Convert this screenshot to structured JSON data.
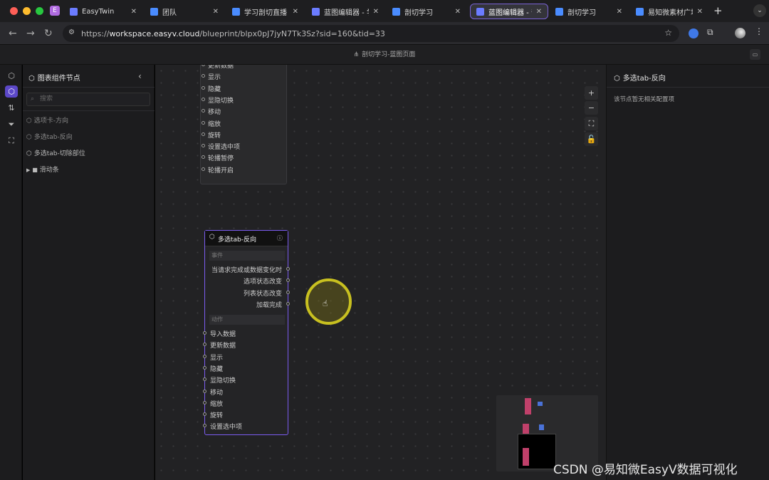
{
  "browser": {
    "traffic_lights": [
      "#ff5f57",
      "#febc2e",
      "#28c840"
    ],
    "tabs": [
      {
        "label": "EasyTwin",
        "icon": "cube-icon",
        "color": "#6b7cff"
      },
      {
        "label": "团队",
        "icon": "doc-icon",
        "color": "#4a8cff"
      },
      {
        "label": "学习剖切直播",
        "icon": "doc-icon",
        "color": "#4a8cff"
      },
      {
        "label": "蓝图编辑器 - 学",
        "icon": "cube-icon",
        "color": "#6b7cff"
      },
      {
        "label": "剖切学习",
        "icon": "doc-icon",
        "color": "#4a8cff"
      },
      {
        "label": "蓝图编辑器 - 剖",
        "icon": "cube-icon",
        "color": "#6b7cff"
      },
      {
        "label": "剖切学习",
        "icon": "doc-icon",
        "color": "#4a8cff"
      },
      {
        "label": "易知微素材广场",
        "icon": "doc-icon",
        "color": "#4a8cff"
      }
    ],
    "active_tab": 5,
    "profile_badge": "E",
    "new_tab": "+",
    "url_prefix": "https://",
    "url_host": "workspace.easyv.cloud",
    "url_path": "/blueprint/blpx0pJ7jyN7Tk3Sz?sid=160&tid=33"
  },
  "app": {
    "title": "剖切学习-蓝图页面"
  },
  "left_panel": {
    "title": "图表组件节点",
    "search_placeholder": "搜索",
    "items": [
      {
        "label": "选项卡-方向",
        "type": "component"
      },
      {
        "label": "多选tab-反向",
        "type": "component"
      },
      {
        "label": "多选tab-切除部位",
        "type": "component"
      },
      {
        "label": "滑动条",
        "type": "folder"
      }
    ]
  },
  "canvas": {
    "top_node_actions": [
      "更新数据",
      "显示",
      "隐藏",
      "显隐切换",
      "移动",
      "缩放",
      "旋转",
      "设置选中项",
      "轮播暂停",
      "轮播开启"
    ],
    "main_node": {
      "title": "多选tab-反向",
      "events_label": "事件",
      "events": [
        "当请求完成或数据变化时",
        "选项状态改变",
        "列表状态改变",
        "加载完成"
      ],
      "actions_label": "动作",
      "actions": [
        "导入数据",
        "更新数据",
        "显示",
        "隐藏",
        "显隐切换",
        "移动",
        "缩放",
        "旋转",
        "设置选中项"
      ]
    },
    "zoom_controls": [
      "+",
      "−"
    ]
  },
  "right_panel": {
    "title": "多选tab-反向",
    "message": "该节点暂无相关配置项"
  },
  "watermark": "CSDN @易知微EasyV数据可视化",
  "colors": {
    "accent": "#6a4fe0",
    "cursor_ring": "#c8c020",
    "minimap_pink": "#c0406a",
    "minimap_blue": "#4a72d8"
  }
}
